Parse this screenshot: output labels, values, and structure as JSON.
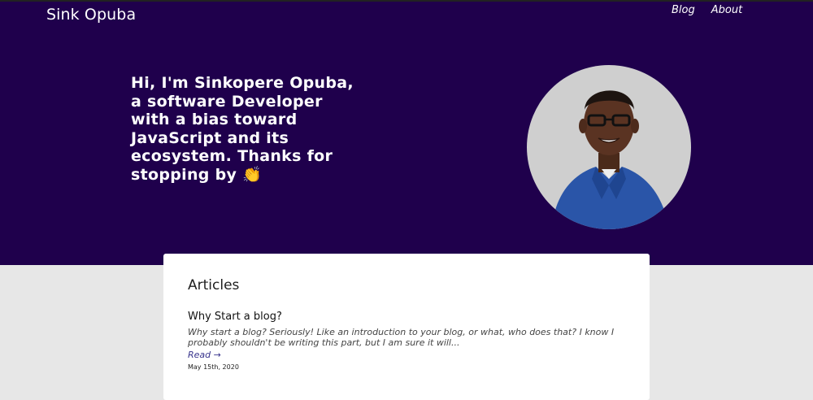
{
  "header": {
    "brand": "Sink Opuba",
    "nav": [
      {
        "label": "Blog"
      },
      {
        "label": "About"
      }
    ]
  },
  "hero": {
    "lines": [
      "Hi, I'm Sinkopere Opuba,",
      "a software Developer",
      "with a bias toward",
      "JavaScript and its",
      "ecosystem. Thanks for",
      "stopping by"
    ],
    "wave_emoji": "👏",
    "profile_photo_icon": "profile-photo"
  },
  "articles": {
    "heading": "Articles",
    "items": [
      {
        "title": "Why Start a blog?",
        "excerpt": "Why start a blog? Seriously! Like an introduction to your blog, or what, who does that? I know I probably shouldn't be writing this part, but I am sure it will...",
        "read_label": "Read →",
        "date": "May 15th, 2020"
      }
    ]
  },
  "colors": {
    "hero_bg": "#1f004c",
    "page_bg": "#e7e7e7",
    "link": "#37338c"
  }
}
